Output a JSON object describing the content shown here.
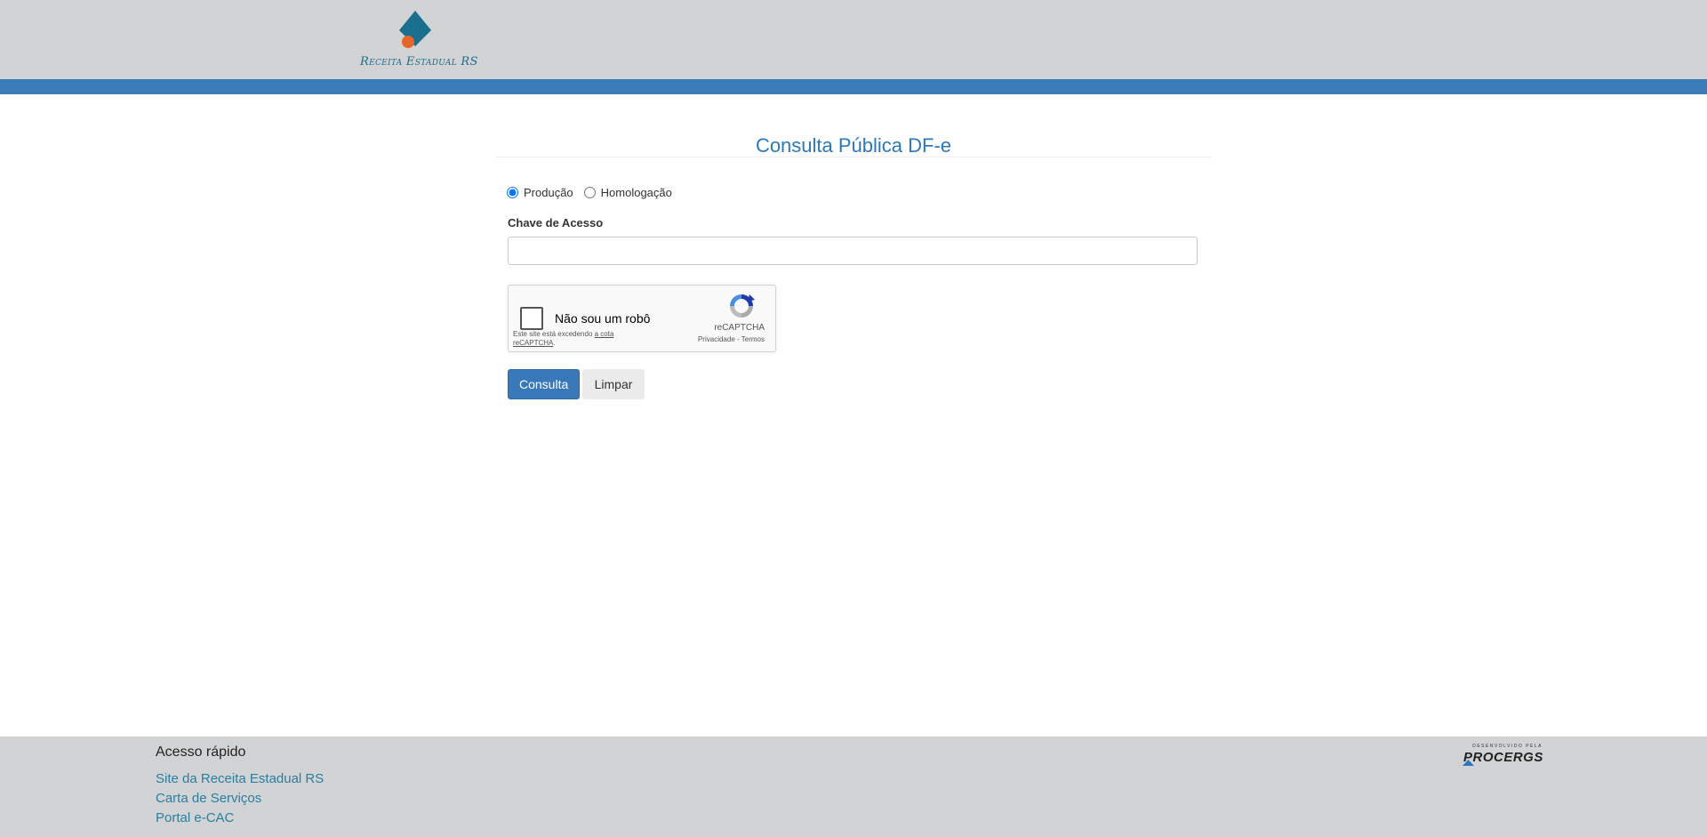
{
  "header": {
    "logo_text": "Receita Estadual RS",
    "brand_color": "#1a6e8e",
    "accent_color": "#e8652a",
    "stripe_color": "#3a7bb8"
  },
  "main": {
    "title": "Consulta Pública DF-e",
    "environment": {
      "options": [
        {
          "label": "Produção",
          "checked": true
        },
        {
          "label": "Homologação",
          "checked": false
        }
      ]
    },
    "access_key": {
      "label": "Chave de Acesso",
      "value": "",
      "placeholder": ""
    },
    "captcha": {
      "label": "Não sou um robô",
      "warning_prefix": "Este site está excedendo",
      "warning_link": "a cota reCAPTCHA",
      "warning_suffix": ".",
      "brand": "reCAPTCHA",
      "privacy": "Privacidade",
      "separator": "-",
      "terms": "Termos",
      "checked": false
    },
    "buttons": {
      "submit": "Consulta",
      "clear": "Limpar"
    }
  },
  "footer": {
    "title": "Acesso rápido",
    "links": [
      {
        "label": "Site da Receita Estadual RS"
      },
      {
        "label": "Carta de Serviços"
      },
      {
        "label": "Portal e-CAC"
      }
    ],
    "developer_prefix": "DESENVOLVIDO PELA",
    "developer_name": "PROCERGS"
  }
}
